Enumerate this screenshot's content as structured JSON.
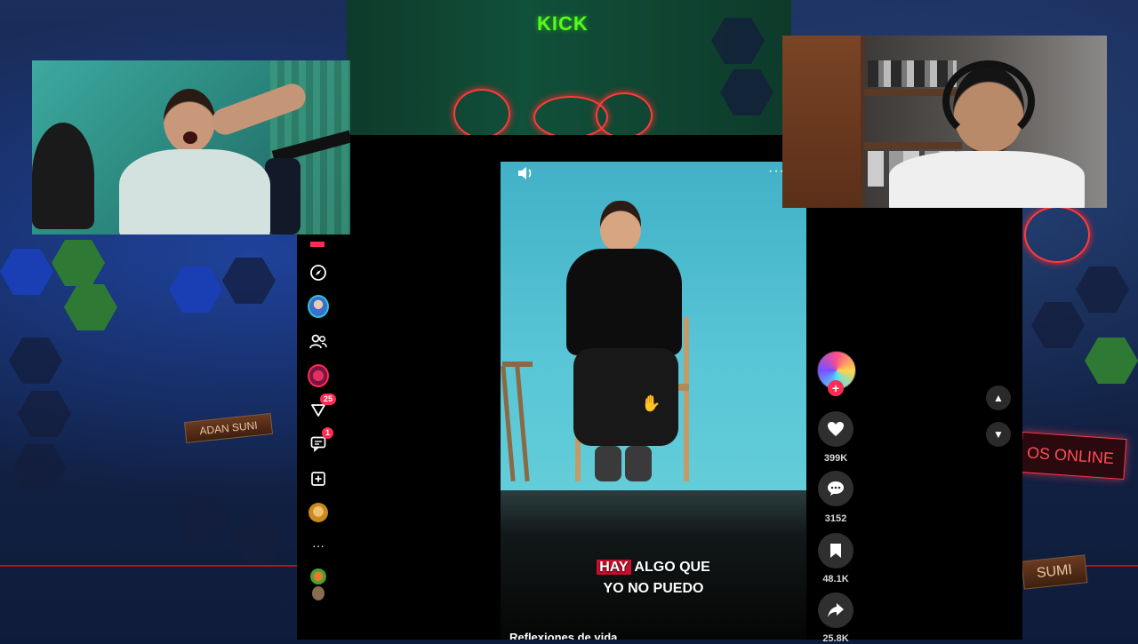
{
  "scene": {
    "kick_logo": "KICK",
    "nameplate_left": "ADAN SUNI",
    "nameplate_right": "SUMI",
    "neon_sign": "OS ONLINE"
  },
  "tiktok": {
    "nav": {
      "explore_icon": "compass-icon",
      "following_icon": "users-icon",
      "inbox_badge": "25",
      "messages_badge": "1",
      "upload_icon": "plus-square-icon",
      "more_label": "···"
    },
    "video": {
      "subtitle_highlight": "HAY",
      "subtitle_line1_rest": " ALGO QUE",
      "subtitle_line2": "YO NO PUEDO",
      "caption": "Reflexiones de vida",
      "more_label": "···"
    },
    "actions": {
      "follow_label": "+",
      "likes": "399K",
      "comments": "3152",
      "saves": "48.1K",
      "shares": "25.8K"
    },
    "scroll": {
      "up_label": "▲",
      "down_label": "▼"
    }
  },
  "colors": {
    "tiktok_red": "#fe2c55",
    "kick_green": "#53fc18",
    "neon_red": "#ff3b3b"
  }
}
